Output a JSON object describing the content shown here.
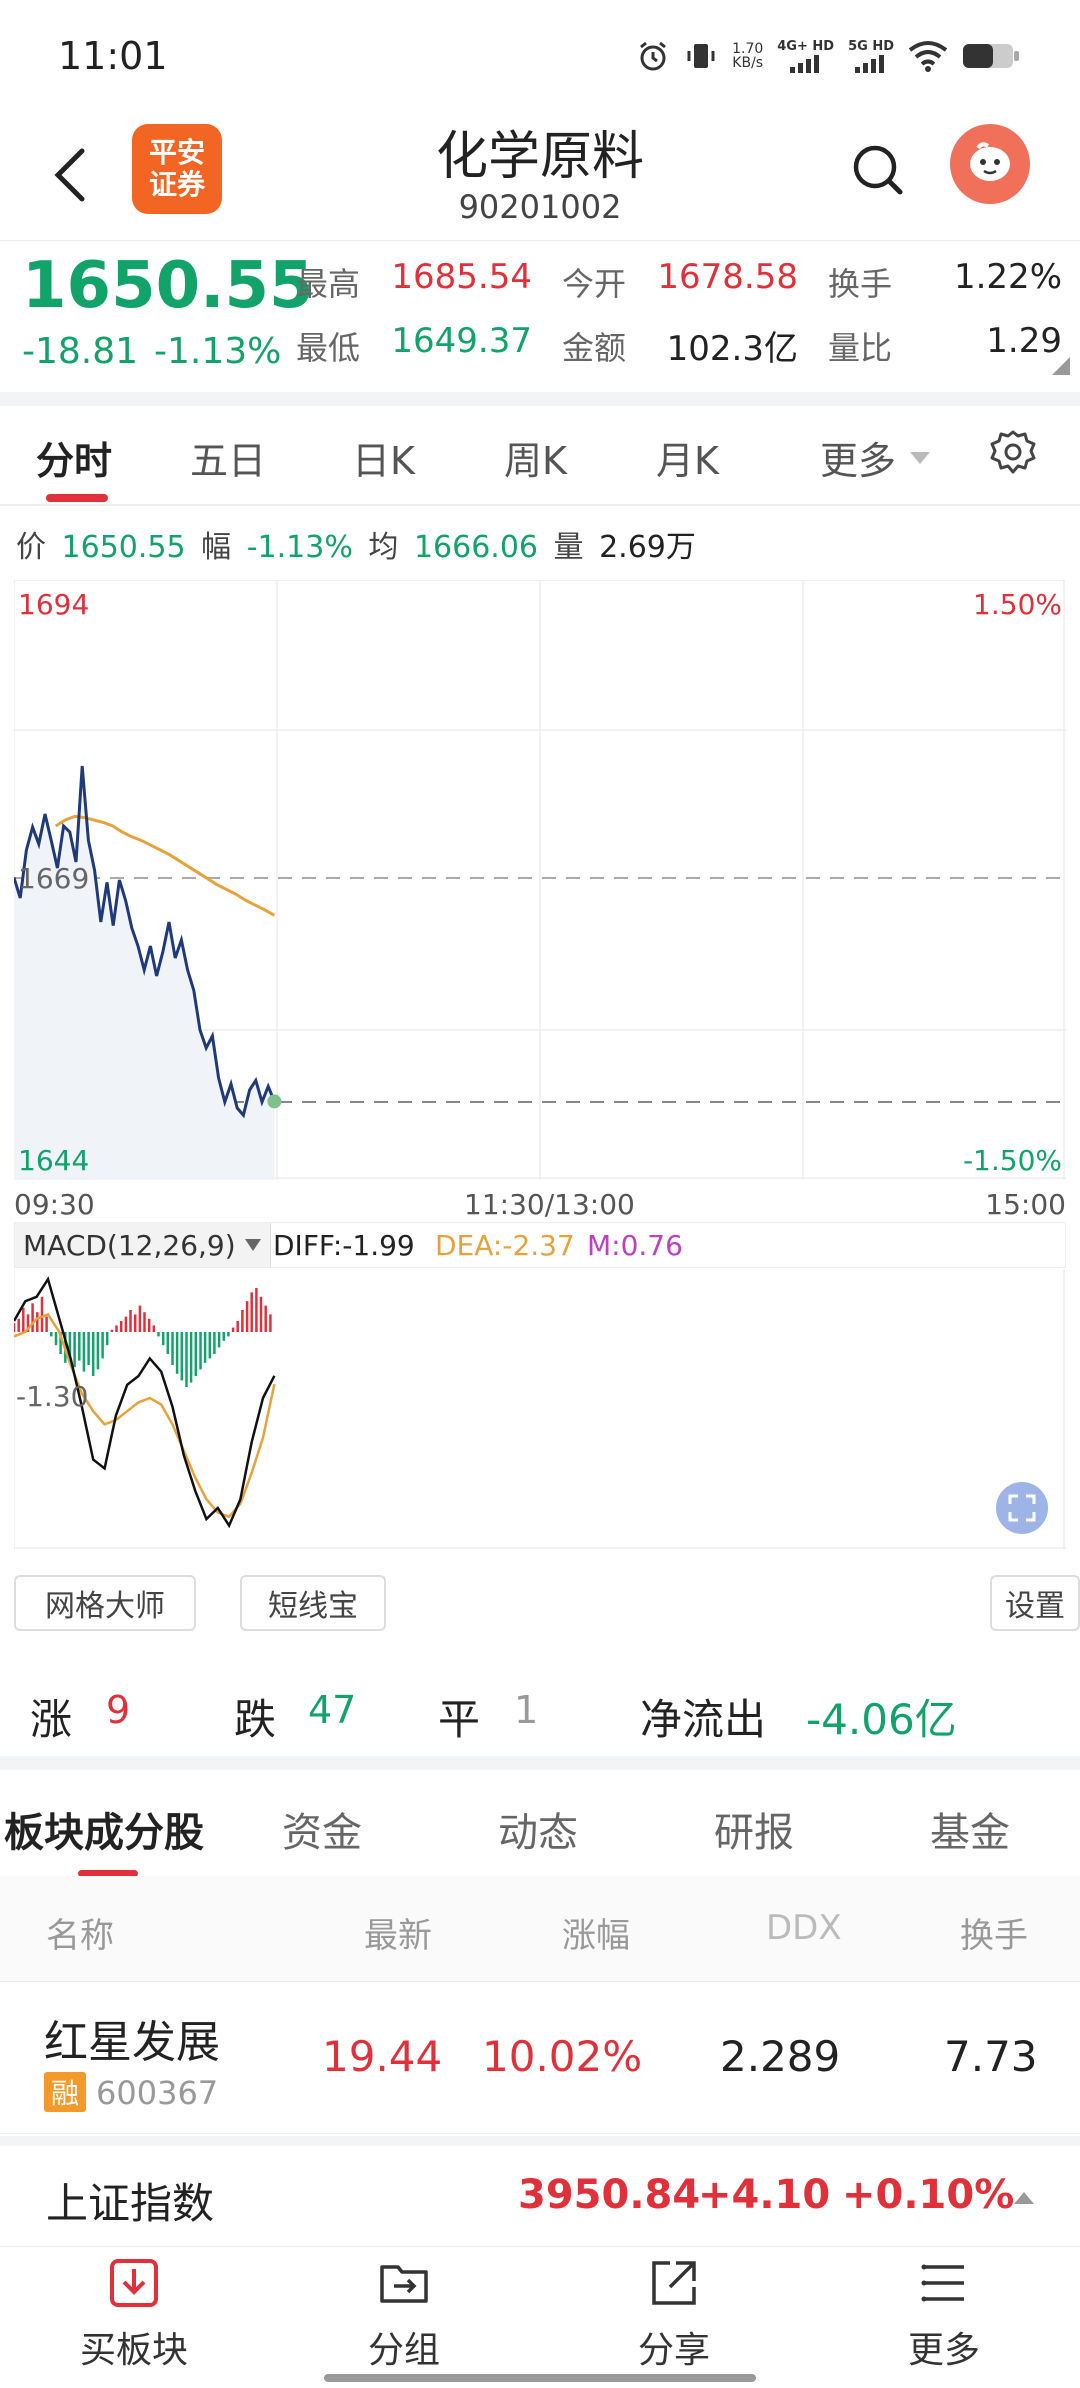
{
  "status_bar": {
    "time": "11:01",
    "net_speed": "1.70",
    "net_unit": "KB/s",
    "sig1": "4G+ HD",
    "sig2": "5G HD"
  },
  "header": {
    "logo_line1": "平安",
    "logo_line2": "证券",
    "title": "化学原料",
    "code": "90201002"
  },
  "quote": {
    "price": "1650.55",
    "change": "-18.81",
    "change_pct": "-1.13%",
    "high_label": "最高",
    "high": "1685.54",
    "low_label": "最低",
    "low": "1649.37",
    "open_label": "今开",
    "open": "1678.58",
    "amount_label": "金额",
    "amount": "102.3亿",
    "turnover_label": "换手",
    "turnover": "1.22%",
    "vol_ratio_label": "量比",
    "vol_ratio": "1.29"
  },
  "tabs": [
    "分时",
    "五日",
    "日K",
    "周K",
    "月K",
    "更多"
  ],
  "info": {
    "price_label": "价",
    "price": "1650.55",
    "pct_label": "幅",
    "pct": "-1.13%",
    "avg_label": "均",
    "avg": "1666.06",
    "vol_label": "量",
    "vol": "2.69万"
  },
  "chart_labels": {
    "y_top": "1694",
    "y_mid": "1669",
    "y_bottom": "1644",
    "pct_top": "1.50%",
    "pct_bottom": "-1.50%",
    "t_start": "09:30",
    "t_mid": "11:30/13:00",
    "t_end": "15:00"
  },
  "chart_data": {
    "type": "line",
    "ylim": [
      1644,
      1694
    ],
    "series": [
      {
        "values": [
          1669.2,
          1667.5,
          1671.5,
          1673.4,
          1672.0,
          1674.5,
          1672.3,
          1670.0,
          1673.5,
          1673.0,
          1670.5,
          1678.5,
          1672.3,
          1669.8,
          1665.5,
          1668.8,
          1665.2,
          1669.0,
          1667.3,
          1665.0,
          1663.5,
          1661.5,
          1663.5,
          1661.0,
          1663.0,
          1665.5,
          1662.5,
          1664.0,
          1661.5,
          1659.8,
          1656.5,
          1655.0,
          1656.0,
          1652.5,
          1650.5,
          1652.0,
          1650.0,
          1649.4,
          1651.5,
          1652.3,
          1650.5,
          1651.8,
          1650.55
        ]
      },
      {
        "values": [
          1673.5,
          1674.0,
          1674.3,
          1674.2,
          1674.0,
          1673.8,
          1673.5,
          1673.0,
          1672.6,
          1672.3,
          1671.9,
          1671.5,
          1671.1,
          1670.6,
          1670.1,
          1669.6,
          1669.1,
          1668.6,
          1668.2,
          1667.8,
          1667.3,
          1666.9,
          1666.5,
          1666.06
        ]
      }
    ]
  },
  "macd": {
    "label": "MACD(12,26,9)",
    "diff": "DIFF:-1.99",
    "dea": "DEA:-2.37",
    "m": "M:0.76",
    "y_label": "-1.30",
    "hist": [
      0.4,
      0.6,
      1.1,
      0.8,
      1.3,
      0.9,
      1.6,
      0.7,
      -0.2,
      -0.6,
      -1.0,
      -1.4,
      -1.1,
      -1.6,
      -1.3,
      -1.8,
      -1.5,
      -2.0,
      -1.7,
      -1.2,
      -0.6,
      0.1,
      0.3,
      0.5,
      0.7,
      1.0,
      0.8,
      1.2,
      0.9,
      0.6,
      0.3,
      -0.2,
      -0.6,
      -1.0,
      -1.5,
      -1.9,
      -2.2,
      -2.5,
      -2.3,
      -2.0,
      -1.7,
      -1.4,
      -1.2,
      -1.0,
      -0.7,
      -0.4,
      -0.2,
      0.2,
      0.5,
      1.0,
      1.4,
      1.8,
      2.0,
      1.6,
      1.2,
      0.8
    ],
    "diff_values": [
      0.5,
      1.4,
      1.6,
      2.4,
      0.6,
      -1.2,
      -3.4,
      -5.8,
      -6.2,
      -3.8,
      -2.4,
      -2.0,
      -1.2,
      -1.8,
      -3.4,
      -5.6,
      -7.2,
      -8.5,
      -8.0,
      -8.8,
      -7.6,
      -5.0,
      -3.0,
      -1.99
    ],
    "dea_values": [
      -0.2,
      0.0,
      0.6,
      0.8,
      0.0,
      -1.5,
      -2.8,
      -3.6,
      -4.2,
      -4.0,
      -3.6,
      -3.2,
      -3.0,
      -3.3,
      -4.2,
      -5.4,
      -6.6,
      -7.6,
      -8.2,
      -8.4,
      -7.8,
      -6.4,
      -4.8,
      -2.37
    ]
  },
  "buttons": {
    "grid_master": "网格大师",
    "short_line": "短线宝",
    "settings": "设置"
  },
  "counts": {
    "up_label": "涨",
    "up": "9",
    "down_label": "跌",
    "down": "47",
    "flat_label": "平",
    "flat": "1",
    "flow_label": "净流出",
    "flow": "-4.06亿"
  },
  "sub_tabs": [
    "板块成分股",
    "资金",
    "动态",
    "研报",
    "基金"
  ],
  "table": {
    "headers": [
      "名称",
      "最新",
      "涨幅",
      "DDX",
      "换手"
    ],
    "rows": [
      {
        "name": "红星发展",
        "badge": "融",
        "code": "600367",
        "latest": "19.44",
        "change": "10.02%",
        "ddx": "2.289",
        "turnover": "7.73"
      }
    ]
  },
  "index_bar": {
    "name": "上证指数",
    "value": "3950.84",
    "change": "+4.10",
    "pct": "+0.10%"
  },
  "bottom_nav": [
    "买板块",
    "分组",
    "分享",
    "更多"
  ],
  "colors": {
    "up": "#e0303a",
    "down": "#12a36b",
    "price_line": "#1f3a7a",
    "avg_line": "#e8a23c"
  }
}
